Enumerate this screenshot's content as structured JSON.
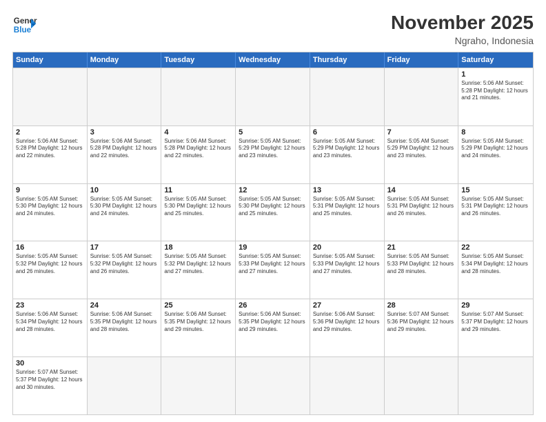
{
  "header": {
    "logo_general": "General",
    "logo_blue": "Blue",
    "title": "November 2025",
    "subtitle": "Ngraho, Indonesia"
  },
  "days_of_week": [
    "Sunday",
    "Monday",
    "Tuesday",
    "Wednesday",
    "Thursday",
    "Friday",
    "Saturday"
  ],
  "weeks": [
    [
      {
        "day": "",
        "info": "",
        "empty": true
      },
      {
        "day": "",
        "info": "",
        "empty": true
      },
      {
        "day": "",
        "info": "",
        "empty": true
      },
      {
        "day": "",
        "info": "",
        "empty": true
      },
      {
        "day": "",
        "info": "",
        "empty": true
      },
      {
        "day": "",
        "info": "",
        "empty": true
      },
      {
        "day": "1",
        "info": "Sunrise: 5:06 AM\nSunset: 5:28 PM\nDaylight: 12 hours\nand 21 minutes.",
        "empty": false
      }
    ],
    [
      {
        "day": "2",
        "info": "Sunrise: 5:06 AM\nSunset: 5:28 PM\nDaylight: 12 hours\nand 22 minutes.",
        "empty": false
      },
      {
        "day": "3",
        "info": "Sunrise: 5:06 AM\nSunset: 5:28 PM\nDaylight: 12 hours\nand 22 minutes.",
        "empty": false
      },
      {
        "day": "4",
        "info": "Sunrise: 5:06 AM\nSunset: 5:28 PM\nDaylight: 12 hours\nand 22 minutes.",
        "empty": false
      },
      {
        "day": "5",
        "info": "Sunrise: 5:05 AM\nSunset: 5:29 PM\nDaylight: 12 hours\nand 23 minutes.",
        "empty": false
      },
      {
        "day": "6",
        "info": "Sunrise: 5:05 AM\nSunset: 5:29 PM\nDaylight: 12 hours\nand 23 minutes.",
        "empty": false
      },
      {
        "day": "7",
        "info": "Sunrise: 5:05 AM\nSunset: 5:29 PM\nDaylight: 12 hours\nand 23 minutes.",
        "empty": false
      },
      {
        "day": "8",
        "info": "Sunrise: 5:05 AM\nSunset: 5:29 PM\nDaylight: 12 hours\nand 24 minutes.",
        "empty": false
      }
    ],
    [
      {
        "day": "9",
        "info": "Sunrise: 5:05 AM\nSunset: 5:30 PM\nDaylight: 12 hours\nand 24 minutes.",
        "empty": false
      },
      {
        "day": "10",
        "info": "Sunrise: 5:05 AM\nSunset: 5:30 PM\nDaylight: 12 hours\nand 24 minutes.",
        "empty": false
      },
      {
        "day": "11",
        "info": "Sunrise: 5:05 AM\nSunset: 5:30 PM\nDaylight: 12 hours\nand 25 minutes.",
        "empty": false
      },
      {
        "day": "12",
        "info": "Sunrise: 5:05 AM\nSunset: 5:30 PM\nDaylight: 12 hours\nand 25 minutes.",
        "empty": false
      },
      {
        "day": "13",
        "info": "Sunrise: 5:05 AM\nSunset: 5:31 PM\nDaylight: 12 hours\nand 25 minutes.",
        "empty": false
      },
      {
        "day": "14",
        "info": "Sunrise: 5:05 AM\nSunset: 5:31 PM\nDaylight: 12 hours\nand 26 minutes.",
        "empty": false
      },
      {
        "day": "15",
        "info": "Sunrise: 5:05 AM\nSunset: 5:31 PM\nDaylight: 12 hours\nand 26 minutes.",
        "empty": false
      }
    ],
    [
      {
        "day": "16",
        "info": "Sunrise: 5:05 AM\nSunset: 5:32 PM\nDaylight: 12 hours\nand 26 minutes.",
        "empty": false
      },
      {
        "day": "17",
        "info": "Sunrise: 5:05 AM\nSunset: 5:32 PM\nDaylight: 12 hours\nand 26 minutes.",
        "empty": false
      },
      {
        "day": "18",
        "info": "Sunrise: 5:05 AM\nSunset: 5:32 PM\nDaylight: 12 hours\nand 27 minutes.",
        "empty": false
      },
      {
        "day": "19",
        "info": "Sunrise: 5:05 AM\nSunset: 5:33 PM\nDaylight: 12 hours\nand 27 minutes.",
        "empty": false
      },
      {
        "day": "20",
        "info": "Sunrise: 5:05 AM\nSunset: 5:33 PM\nDaylight: 12 hours\nand 27 minutes.",
        "empty": false
      },
      {
        "day": "21",
        "info": "Sunrise: 5:05 AM\nSunset: 5:33 PM\nDaylight: 12 hours\nand 28 minutes.",
        "empty": false
      },
      {
        "day": "22",
        "info": "Sunrise: 5:05 AM\nSunset: 5:34 PM\nDaylight: 12 hours\nand 28 minutes.",
        "empty": false
      }
    ],
    [
      {
        "day": "23",
        "info": "Sunrise: 5:06 AM\nSunset: 5:34 PM\nDaylight: 12 hours\nand 28 minutes.",
        "empty": false
      },
      {
        "day": "24",
        "info": "Sunrise: 5:06 AM\nSunset: 5:35 PM\nDaylight: 12 hours\nand 28 minutes.",
        "empty": false
      },
      {
        "day": "25",
        "info": "Sunrise: 5:06 AM\nSunset: 5:35 PM\nDaylight: 12 hours\nand 29 minutes.",
        "empty": false
      },
      {
        "day": "26",
        "info": "Sunrise: 5:06 AM\nSunset: 5:35 PM\nDaylight: 12 hours\nand 29 minutes.",
        "empty": false
      },
      {
        "day": "27",
        "info": "Sunrise: 5:06 AM\nSunset: 5:36 PM\nDaylight: 12 hours\nand 29 minutes.",
        "empty": false
      },
      {
        "day": "28",
        "info": "Sunrise: 5:07 AM\nSunset: 5:36 PM\nDaylight: 12 hours\nand 29 minutes.",
        "empty": false
      },
      {
        "day": "29",
        "info": "Sunrise: 5:07 AM\nSunset: 5:37 PM\nDaylight: 12 hours\nand 29 minutes.",
        "empty": false
      }
    ],
    [
      {
        "day": "30",
        "info": "Sunrise: 5:07 AM\nSunset: 5:37 PM\nDaylight: 12 hours\nand 30 minutes.",
        "empty": false
      },
      {
        "day": "",
        "info": "",
        "empty": true
      },
      {
        "day": "",
        "info": "",
        "empty": true
      },
      {
        "day": "",
        "info": "",
        "empty": true
      },
      {
        "day": "",
        "info": "",
        "empty": true
      },
      {
        "day": "",
        "info": "",
        "empty": true
      },
      {
        "day": "",
        "info": "",
        "empty": true
      }
    ]
  ]
}
